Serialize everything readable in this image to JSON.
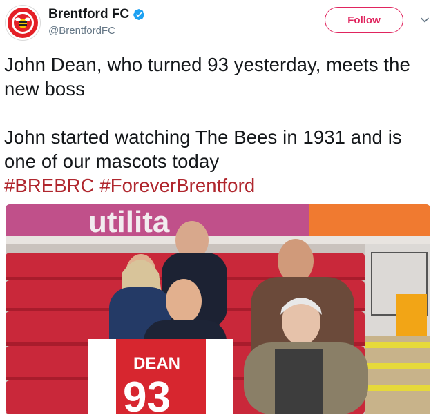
{
  "account": {
    "display_name": "Brentford FC",
    "handle": "@BrentfordFC",
    "verified": true
  },
  "follow_button": {
    "label": "Follow"
  },
  "tweet": {
    "line1": "John Dean, who turned 93 yesterday, meets the new boss",
    "line2": "John started watching The Bees in 1931 and is one of our mascots today",
    "hashtags": [
      "#BREBRC",
      "#ForeverBrentford"
    ]
  },
  "photo": {
    "shirt_name": "DEAN",
    "shirt_number": "93",
    "banner_text": "utilita",
    "credit": "©BRENTFORDFC"
  },
  "colors": {
    "brand_red": "#e0245e",
    "hashtag": "#b0272e",
    "verified_blue": "#1da1f2",
    "secondary_text": "#657786"
  },
  "icons": [
    "crest-icon",
    "verified-badge-icon",
    "chevron-down-icon"
  ]
}
